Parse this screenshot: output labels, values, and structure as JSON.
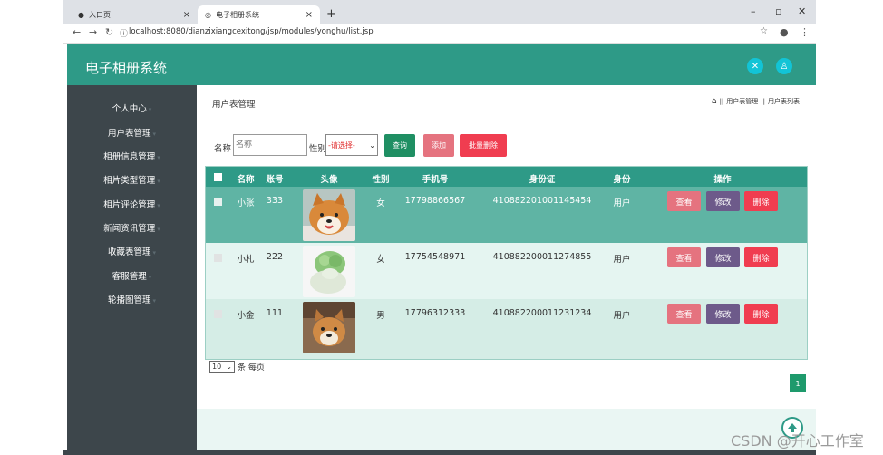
{
  "browser": {
    "tabs": [
      {
        "label": "入口页",
        "close": "×"
      },
      {
        "label": "电子相册系统",
        "close": "×"
      }
    ],
    "new_tab": "+",
    "window_controls": [
      "–",
      "▫",
      "✕"
    ],
    "url": "localhost:8080/dianzixiangcexitong/jsp/modules/yonghu/list.jsp"
  },
  "header": {
    "title": "电子相册系统",
    "accent": "#2e9a87"
  },
  "sidebar": {
    "items": [
      {
        "label": "个人中心"
      },
      {
        "label": "用户表管理"
      },
      {
        "label": "相册信息管理"
      },
      {
        "label": "相片类型管理"
      },
      {
        "label": "相片评论管理"
      },
      {
        "label": "新闻资讯管理"
      },
      {
        "label": "收藏表管理"
      },
      {
        "label": "客服管理"
      },
      {
        "label": "轮播图管理"
      }
    ]
  },
  "main": {
    "title": "用户表管理",
    "breadcrumb": [
      "用户表管理",
      "用户表列表"
    ],
    "breadcrumb_sep": "||",
    "search": {
      "name_label": "名称",
      "name_placeholder": "名称",
      "gender_label": "性别",
      "gender_selected": "-请选择-",
      "query_button": "查询",
      "add_button": "添加",
      "batch_delete_button": "批量删除"
    },
    "table": {
      "headers": [
        "名称",
        "账号",
        "头像",
        "性别",
        "手机号",
        "身份证",
        "身份",
        "操作"
      ],
      "rows": [
        {
          "name": "小张",
          "account": "333",
          "gender": "女",
          "phone": "17798866567",
          "id_card": "410882201001145454",
          "role": "用户",
          "avatar": "shiba-photo"
        },
        {
          "name": "小札",
          "account": "222",
          "gender": "女",
          "phone": "17754548971",
          "id_card": "410882200011274855",
          "role": "用户",
          "avatar": "cabbage-photo"
        },
        {
          "name": "小金",
          "account": "111",
          "gender": "男",
          "phone": "17796312333",
          "id_card": "410882200011231234",
          "role": "用户",
          "avatar": "shiba-puppy-photo"
        }
      ],
      "actions": {
        "view": "查看",
        "edit": "修改",
        "delete": "删除"
      }
    },
    "pagination": {
      "page_size": "10",
      "page_size_suffix": "条 每页",
      "current_page": "1"
    }
  },
  "watermark": "CSDN @开心工作室",
  "colors": {
    "teal": "#2e9a87",
    "view": "#e5737f",
    "edit": "#6d5a8a",
    "delete": "#f03d50",
    "query": "#1f8f63"
  }
}
